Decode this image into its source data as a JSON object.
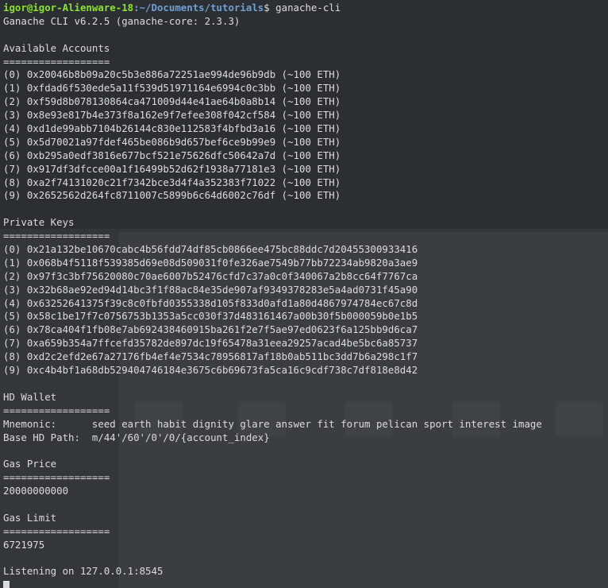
{
  "prompt": {
    "user_host": "igor@igor-Alienware-18",
    "path": ":~/Documents/tutorials",
    "symbol": "$ ",
    "command": "ganache-cli"
  },
  "version_line": "Ganache CLI v6.2.5 (ganache-core: 2.3.3)",
  "accounts": {
    "title": "Available Accounts",
    "separator": "==================",
    "items": [
      "(0) 0x20046b8b09a20c5b3e886a72251ae994de96b9db (~100 ETH)",
      "(1) 0xfdad6f530ede5a11f539d51971164e6994c0c3bb (~100 ETH)",
      "(2) 0xf59d8b078130864ca471009d44e41ae64b0a8b14 (~100 ETH)",
      "(3) 0x8e93e817b4e373f8a162e9f7efee308f042cf584 (~100 ETH)",
      "(4) 0xd1de99abb7104b26144c830e112583f4bfbd3a16 (~100 ETH)",
      "(5) 0x5d70021a97fdef465be086b9d657bef6ce9b99e9 (~100 ETH)",
      "(6) 0xb295a0edf3816e677bcf521e75626dfc50642a7d (~100 ETH)",
      "(7) 0x917df3dfcce00a1f16499b52d62f1938a77181e3 (~100 ETH)",
      "(8) 0xa2f74131020c21f7342bce3d4f4a352383f71022 (~100 ETH)",
      "(9) 0x2652562d264fc8711007c5899b6c64d6002c76df (~100 ETH)"
    ]
  },
  "private_keys": {
    "title": "Private Keys",
    "separator": "==================",
    "items": [
      "(0) 0x21a132be10670cabc4b56fdd74df85cb0866ee475bc88ddc7d20455300933416",
      "(1) 0x068b4f5118f539385d69e08d509031f0fe326ae7549b77bb72234ab9820a3ae9",
      "(2) 0x97f3c3bf75620080c70ae6007b52476cfd7c37a0c0f340067a2b8cc64f7767ca",
      "(3) 0x32b68ae92ed94d14bc3f1f88ac84e35de907af9349378283e5a4ad0731f45a90",
      "(4) 0x63252641375f39c8c0fbfd0355338d105f833d0afd1a80d4867974784ec67c8d",
      "(5) 0x58c1be17f7c0756753b1353a5cc030f37d483161467a00b30f5b000059b0e1b5",
      "(6) 0x78ca404f1fb08e7ab692438460915ba261f2e7f5ae97ed0623f6a125bb9d6ca7",
      "(7) 0xa659b354a7ffcefd35782de897dc19f65478a31eea29257acad4be5bc6a85737",
      "(8) 0xd2c2efd2e67a27176fb4ef4e7534c78956817af18b0ab511bc3dd7b6a298c1f7",
      "(9) 0xc4b4bf1a68db529404746184e3675c6b69673fa5ca16c9cdf738c7df818e8d42"
    ]
  },
  "hd_wallet": {
    "title": "HD Wallet",
    "separator": "==================",
    "mnemonic_line": "Mnemonic:      seed earth habit dignity glare answer fit forum pelican sport interest image",
    "path_line": "Base HD Path:  m/44'/60'/0'/0/{account_index}"
  },
  "gas_price": {
    "title": "Gas Price",
    "separator": "==================",
    "value": "20000000000"
  },
  "gas_limit": {
    "title": "Gas Limit",
    "separator": "==================",
    "value": "6721975"
  },
  "listening_line": "Listening on 127.0.0.1:8545"
}
